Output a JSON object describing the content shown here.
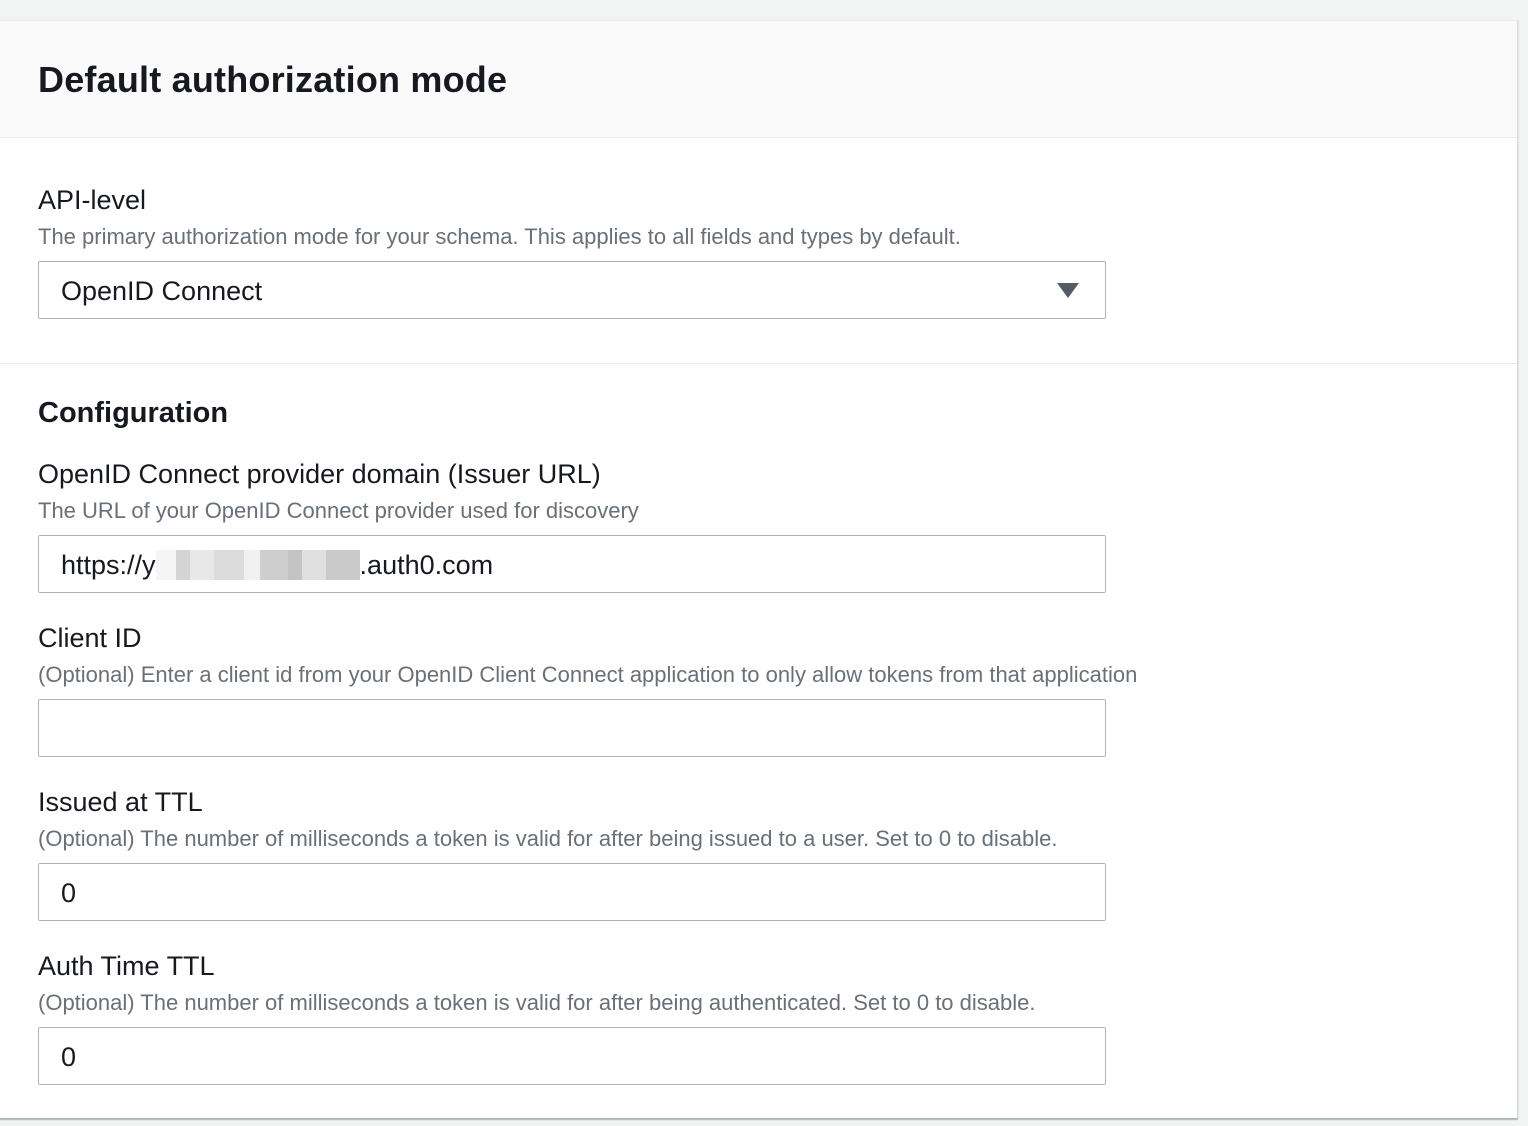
{
  "panel": {
    "title": "Default authorization mode"
  },
  "api_level": {
    "label": "API-level",
    "description": "The primary authorization mode for your schema. This applies to all fields and types by default.",
    "selected": "OpenID Connect",
    "icon": "caret-down-icon"
  },
  "configuration": {
    "heading": "Configuration",
    "issuer": {
      "label": "OpenID Connect provider domain (Issuer URL)",
      "description": "The URL of your OpenID Connect provider used for discovery",
      "value_prefix": "https://y",
      "value_suffix": ".auth0.com"
    },
    "client_id": {
      "label": "Client ID",
      "description": "(Optional) Enter a client id from your OpenID Client Connect application to only allow tokens from that application",
      "value": ""
    },
    "issued_ttl": {
      "label": "Issued at TTL",
      "description": "(Optional) The number of milliseconds a token is valid for after being issued to a user. Set to 0 to disable.",
      "value": "0"
    },
    "auth_ttl": {
      "label": "Auth Time TTL",
      "description": "(Optional) The number of milliseconds a token is valid for after being authenticated. Set to 0 to disable.",
      "value": "0"
    }
  },
  "colors": {
    "text": "#16191f",
    "description": "#687078",
    "border": "#aab7b8",
    "header_bg": "#fafafa"
  }
}
